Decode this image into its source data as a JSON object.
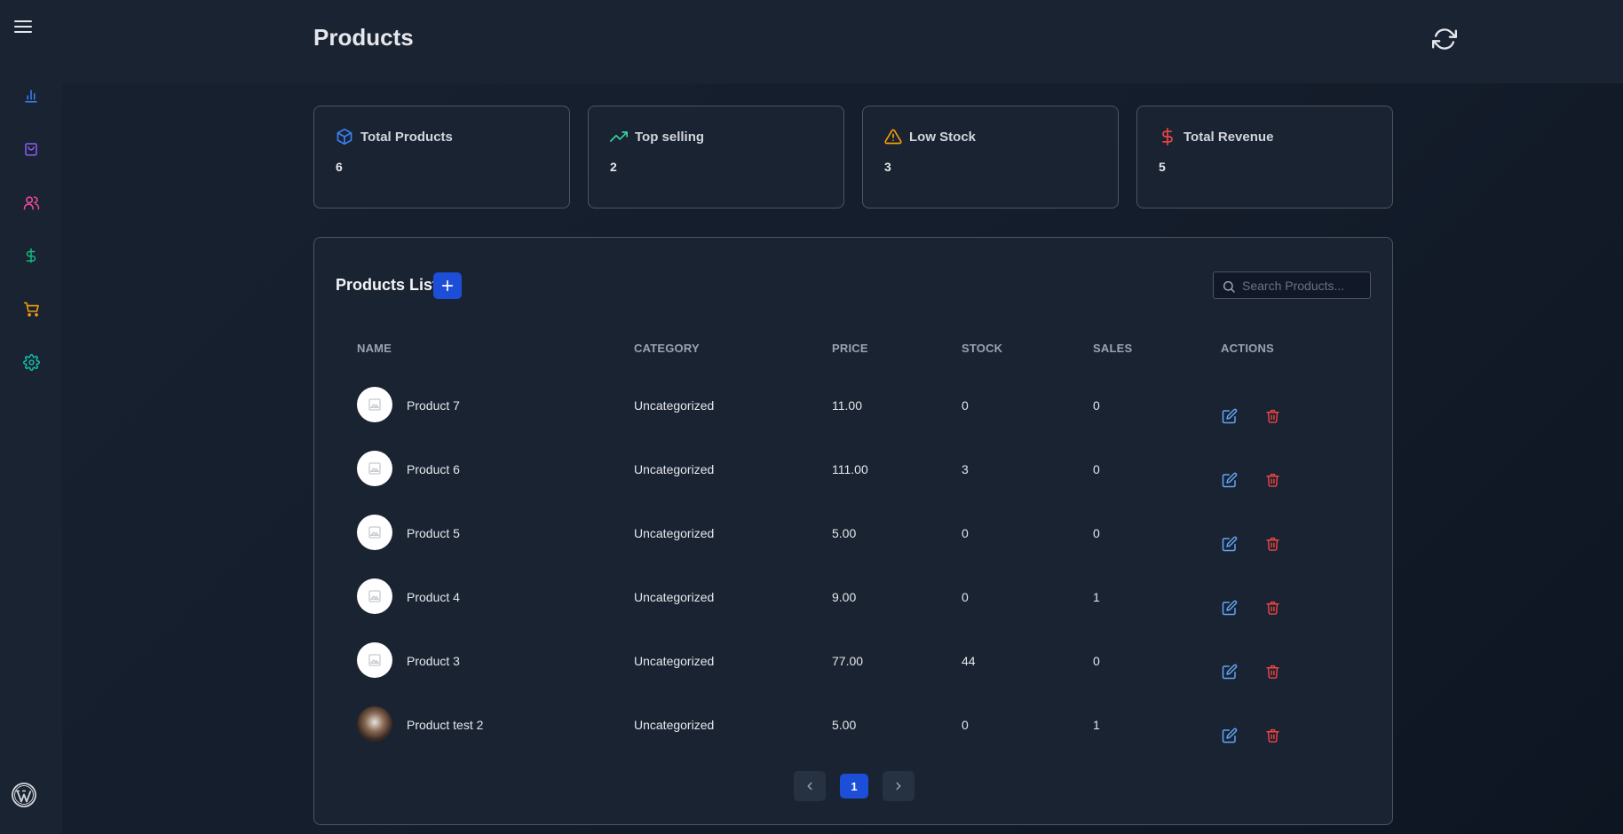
{
  "header": {
    "title": "Products"
  },
  "colors": {
    "accent": "#1d4ed8",
    "chart_icon": "#3b82f6",
    "bag_icon": "#8b5cf6",
    "users_icon": "#ec4899",
    "dollar_icon": "#10b981",
    "cart_icon": "#f59e0b",
    "gear_icon": "#14b8a6",
    "edit_icon": "#60a5fa",
    "delete_icon": "#ef4444"
  },
  "sidebar": {
    "items": [
      {
        "name": "analytics",
        "icon": "bar-chart-icon"
      },
      {
        "name": "products",
        "icon": "shopping-bag-icon"
      },
      {
        "name": "customers",
        "icon": "users-icon"
      },
      {
        "name": "revenue",
        "icon": "dollar-icon"
      },
      {
        "name": "orders",
        "icon": "cart-icon"
      },
      {
        "name": "settings",
        "icon": "gear-icon"
      }
    ]
  },
  "stats": [
    {
      "title": "Total Products",
      "value": "6",
      "icon": "cube-icon"
    },
    {
      "title": "Top selling",
      "value": "2",
      "icon": "trending-up-icon"
    },
    {
      "title": "Low Stock",
      "value": "3",
      "icon": "warning-icon"
    },
    {
      "title": "Total Revenue",
      "value": "5",
      "icon": "dollar-icon"
    }
  ],
  "list": {
    "title": "Products List",
    "search_placeholder": "Search Products...",
    "columns": [
      "NAME",
      "CATEGORY",
      "PRICE",
      "STOCK",
      "SALES",
      "ACTIONS"
    ],
    "rows": [
      {
        "name": "Product 7",
        "category": "Uncategorized",
        "price": "11.00",
        "stock": "0",
        "sales": "0",
        "image": "placeholder"
      },
      {
        "name": "Product 6",
        "category": "Uncategorized",
        "price": "111.00",
        "stock": "3",
        "sales": "0",
        "image": "placeholder"
      },
      {
        "name": "Product 5",
        "category": "Uncategorized",
        "price": "5.00",
        "stock": "0",
        "sales": "0",
        "image": "placeholder"
      },
      {
        "name": "Product 4",
        "category": "Uncategorized",
        "price": "9.00",
        "stock": "0",
        "sales": "1",
        "image": "placeholder"
      },
      {
        "name": "Product 3",
        "category": "Uncategorized",
        "price": "77.00",
        "stock": "44",
        "sales": "0",
        "image": "placeholder"
      },
      {
        "name": "Product test 2",
        "category": "Uncategorized",
        "price": "5.00",
        "stock": "0",
        "sales": "1",
        "image": "photo"
      }
    ],
    "pagination": {
      "current_page": "1"
    }
  }
}
